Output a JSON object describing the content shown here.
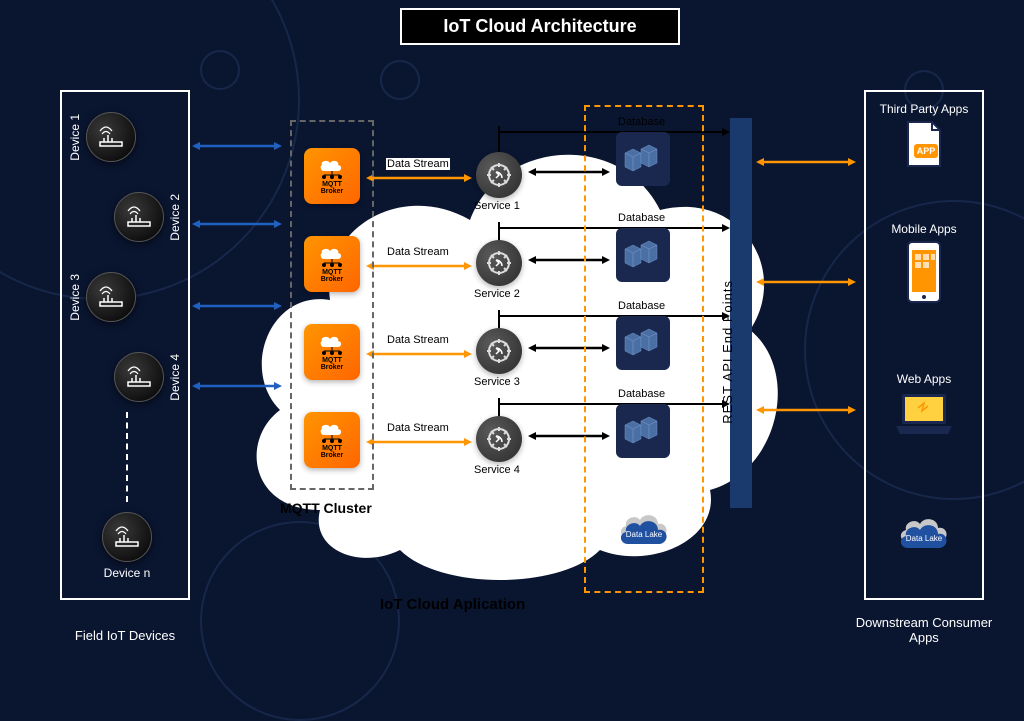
{
  "title": "IoT Cloud Architecture",
  "devices_panel_title": "Field IoT Devices",
  "devices": [
    {
      "label": "Device 1"
    },
    {
      "label": "Device 2"
    },
    {
      "label": "Device 3"
    },
    {
      "label": "Device 4"
    },
    {
      "label": "Device n"
    }
  ],
  "mqtt": {
    "cluster_label": "MQTT Cluster",
    "broker_label_top": "MQTT",
    "broker_label_bottom": "Broker"
  },
  "data_stream_label": "Data Stream",
  "services": [
    {
      "label": "Service 1"
    },
    {
      "label": "Service 2"
    },
    {
      "label": "Service 3"
    },
    {
      "label": "Service 4"
    }
  ],
  "database_label": "Database",
  "data_lake_label": "Data Lake",
  "cloud_title": "IoT Cloud Aplication",
  "rest_api_label": "REST  API  End  Points",
  "consumers_panel_title": "Downstream Consumer Apps",
  "consumers": [
    {
      "label": "Third Party Apps"
    },
    {
      "label": "Mobile Apps"
    },
    {
      "label": "Web Apps"
    },
    {
      "label": ""
    }
  ],
  "colors": {
    "orange": "#ff9500",
    "navy": "#1a2850",
    "blue_arrow": "#2060c0",
    "black": "#000000"
  }
}
